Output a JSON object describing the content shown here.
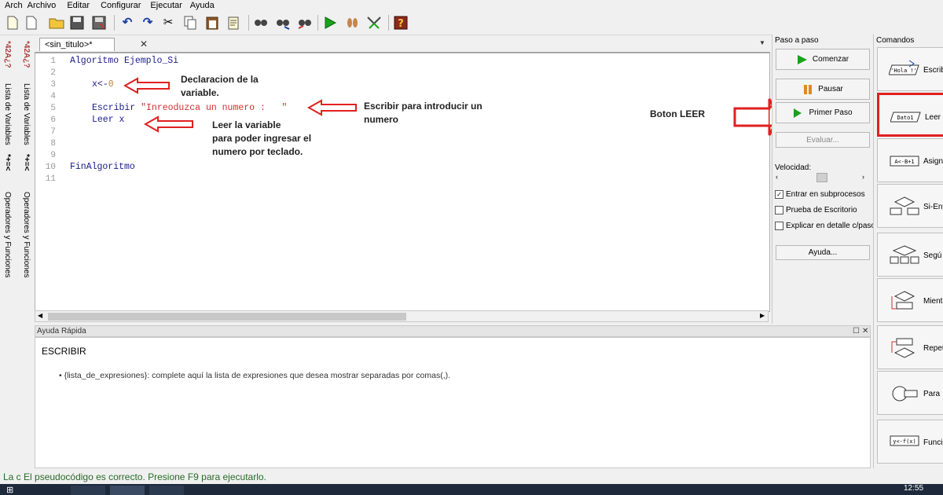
{
  "menu": {
    "items": [
      "Arch",
      "Archivo",
      "Editar",
      "Configurar",
      "Ejecutar",
      "Ayuda"
    ]
  },
  "toolbar": {
    "icons": [
      "new-file-icon",
      "open-folder-icon",
      "save-icon",
      "save-as-icon",
      "print-icon",
      "undo-icon",
      "redo-icon",
      "cut-icon",
      "copy-icon",
      "paste-icon",
      "edit-icon",
      "find-icon",
      "find-next-icon",
      "replace-icon",
      "run-icon",
      "step-icon",
      "debug-icon",
      "help-icon"
    ]
  },
  "sidebar_tabs": {
    "variables_label": "Lista de Variables",
    "variables_icon": "*42A¿?",
    "operators_label": "Operadores y Funciones",
    "operators_icon": "*+=<"
  },
  "editor": {
    "tab_title": "<sin_titulo>*",
    "tab_close": "✕",
    "line_numbers": [
      "1",
      "2",
      "3",
      "4",
      "5",
      "6",
      "7",
      "8",
      "9",
      "10",
      "11"
    ],
    "lines": {
      "l1_kw": "Algoritmo",
      "l1_name": "Ejemplo_Si",
      "l3_var": "x",
      "l3_op": "<-",
      "l3_val": "0",
      "l5_kw": "Escribir",
      "l5_str": "\"Inreoduzca un numero :   \"",
      "l6_kw": "Leer",
      "l6_var": "x",
      "l10_kw": "FinAlgoritmo"
    },
    "annotations": {
      "declaracion_1": "Declaracion de la",
      "declaracion_2": "variable.",
      "escribir_1": "Escribir para introducir un",
      "escribir_2": "numero",
      "leer_1": "Leer la variable",
      "leer_2": "para poder ingresar el",
      "leer_3": "numero por teclado.",
      "boton_leer": "Boton LEER"
    }
  },
  "quick_help": {
    "title": "Ayuda Rápida",
    "heading": "ESCRIBIR",
    "bullet": "{lista_de_expresiones}: complete aquí la lista de expresiones que desea mostrar separadas por comas(,)."
  },
  "paso_a_paso": {
    "title": "Paso a paso",
    "comenzar": "Comenzar",
    "pausar": "Pausar",
    "primer_paso": "Primer Paso",
    "evaluar": "Evaluar...",
    "velocidad": "Velocidad:",
    "entrar_subprocesos": "Entrar en subprocesos",
    "prueba_escritorio": "Prueba de Escritorio",
    "explicar_detalle": "Explicar en detalle c/paso",
    "ayuda": "Ayuda...",
    "entrar_checked": "✓"
  },
  "comandos": {
    "title": "Comandos",
    "items": [
      "Escrib",
      "Leer",
      "Asigna",
      "Si-Ento",
      "Segú",
      "Mientra",
      "Repetir",
      "Para",
      "Funció"
    ],
    "icon_texts": [
      "'Hola !'",
      "Dato1",
      "A<-B+1",
      "",
      "",
      "",
      "",
      "",
      "y<-f(x)"
    ]
  },
  "status": {
    "prefix": "La c",
    "message": "El pseudocódigo es correcto. Presione F9 para ejecutarlo.",
    "clock": "12:55"
  },
  "colors": {
    "annotation_arrow": "#e02020",
    "status_text": "#2a6a2a",
    "keyword": "#1a1a8c",
    "string": "#d03030"
  }
}
